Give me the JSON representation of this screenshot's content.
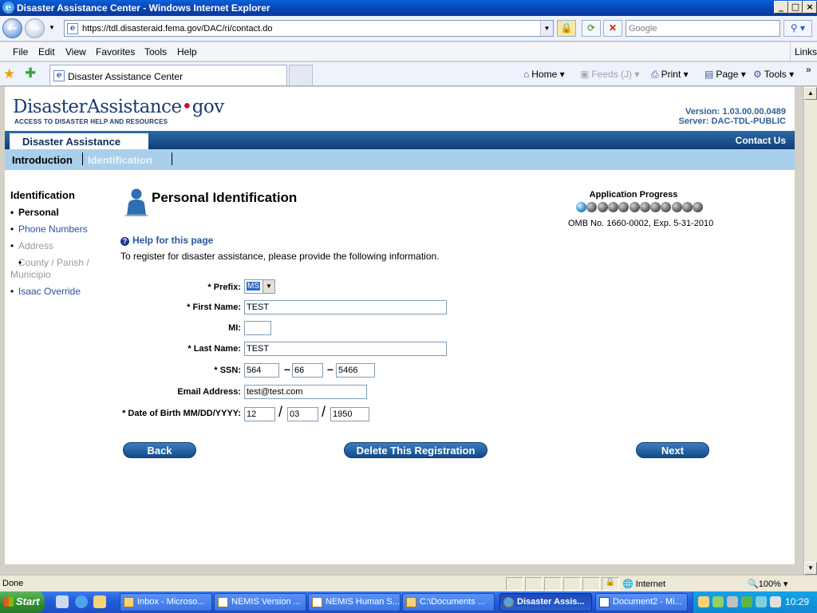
{
  "window": {
    "title": "Disaster Assistance Center - Windows Internet Explorer"
  },
  "browser": {
    "url": "https://tdl.disasteraid.fema.gov/DAC/ri/contact.do",
    "search_placeholder": "Google",
    "menu": [
      "File",
      "Edit",
      "View",
      "Favorites",
      "Tools",
      "Help"
    ],
    "links_label": "Links",
    "tab_title": "Disaster Assistance Center",
    "commands": {
      "home": "Home",
      "feeds": "Feeds (J)",
      "print": "Print",
      "page": "Page",
      "tools": "Tools"
    }
  },
  "site": {
    "logo_word": "DisasterAssistance",
    "logo_dot": "•",
    "logo_gov": "gov",
    "logo_tag": "ACCESS TO DISASTER HELP AND RESOURCES",
    "version": "Version: 1.03.00.00.0489",
    "server": "Server: DAC-TDL-PUBLIC",
    "bar_label": "Disaster Assistance",
    "contact_us": "Contact Us",
    "nav_intro": "Introduction",
    "nav_ident": "Identification"
  },
  "sidebar": {
    "heading": "Identification",
    "items": [
      "Personal",
      "Phone Numbers",
      "Address",
      "County / Parish / Municipio",
      "Isaac Override"
    ]
  },
  "main": {
    "title": "Personal Identification",
    "progress_title": "Application Progress",
    "progress": {
      "current": 1,
      "total": 12
    },
    "omb": "OMB No. 1660-0002, Exp. 5-31-2010",
    "help": "Help for this page",
    "intro": "To register for disaster assistance, please provide the following information."
  },
  "form": {
    "prefix_label": "* Prefix:",
    "prefix_value": "MS",
    "first_label": "* First Name:",
    "first_value": "TEST",
    "mi_label": "MI:",
    "mi_value": "",
    "last_label": "* Last Name:",
    "last_value": "TEST",
    "ssn_label": "* SSN:",
    "ssn1": "564",
    "ssn2": "66",
    "ssn3": "5466",
    "email_label": "Email Address:",
    "email_value": "test@test.com",
    "dob_label": "* Date of Birth MM/DD/YYYY:",
    "dob_mm": "12",
    "dob_dd": "03",
    "dob_yyyy": "1950",
    "dash": "–",
    "slash": "/"
  },
  "buttons": {
    "back": "Back",
    "delete": "Delete This Registration",
    "next": "Next"
  },
  "statusbar": {
    "done": "Done",
    "zone": "Internet",
    "zoom": "100%"
  },
  "taskbar": {
    "start": "Start",
    "items": [
      "Inbox - Microso...",
      "NEMIS Version ...",
      "NEMIS Human S...",
      "C:\\Documents ...",
      "Disaster Assis...",
      "Document2 - Mi..."
    ],
    "clock": "10:29"
  }
}
